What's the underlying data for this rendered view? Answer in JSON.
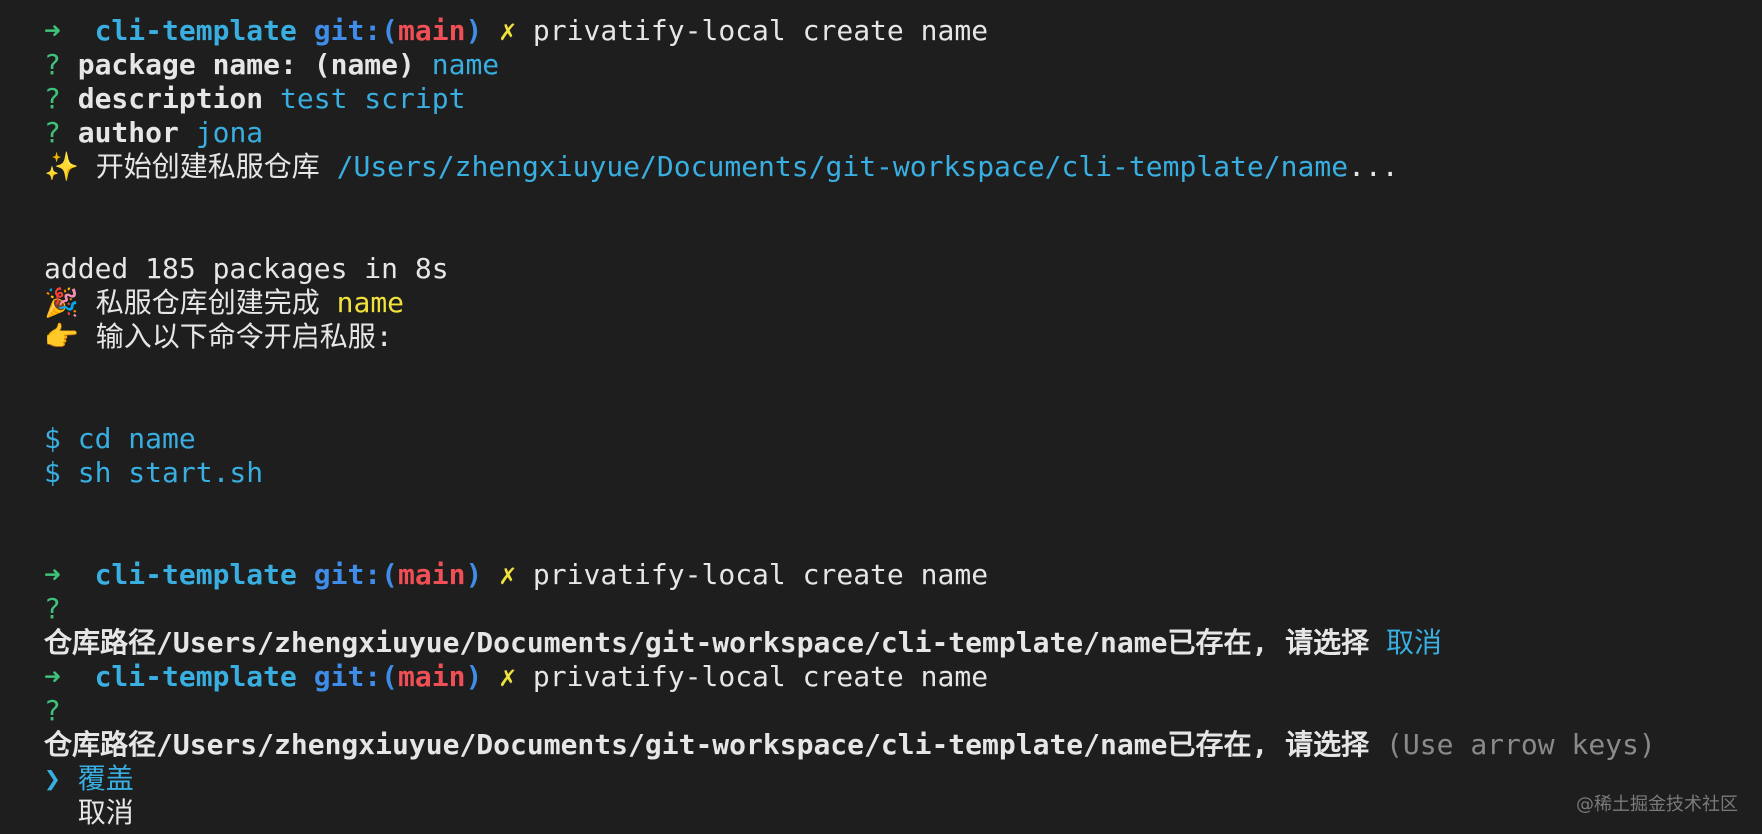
{
  "colors": {
    "background": "#1e1e1e",
    "arrow": "#3ec27a",
    "dir": "#39aee0",
    "git": "#3f8de8",
    "branch": "#ef4f55",
    "dirty": "#f0e23a",
    "answer": "#39aee0",
    "hint": "#8a8a8a"
  },
  "prompt": {
    "arrow": "➜",
    "dir": "cli-template",
    "git_open": "git:(",
    "branch": "main",
    "git_close": ")",
    "dirty": "✗"
  },
  "session1": {
    "command": "privatify-local create name",
    "q_mark": "?",
    "pkg_label": "package name: (name)",
    "pkg_answer": "name",
    "desc_label": "description",
    "desc_answer": "test script",
    "author_label": "author",
    "author_answer": "jona",
    "creating_icon": "✨",
    "creating_text": "开始创建私服仓库",
    "creating_path": "/Users/zhengxiuyue/Documents/git-workspace/cli-template/name",
    "creating_ellipsis": "...",
    "added_text": "added 185 packages in 8s",
    "done_icon": "🎉",
    "done_text": "私服仓库创建完成",
    "done_name": "name",
    "hint_icon": "👉",
    "hint_text": "输入以下命令开启私服:",
    "cmd_prefix": "$",
    "cmd1": "cd name",
    "cmd2": "sh start.sh"
  },
  "session2": {
    "command": "privatify-local create name",
    "q_mark": "?",
    "question": "仓库路径/Users/zhengxiuyue/Documents/git-workspace/cli-template/name已存在, 请选择",
    "answer": "取消"
  },
  "session3": {
    "command": "privatify-local create name",
    "q_mark": "?",
    "question": "仓库路径/Users/zhengxiuyue/Documents/git-workspace/cli-template/name已存在, 请选择",
    "hint": "(Use arrow keys)",
    "pointer": "❯",
    "options": [
      "覆盖",
      "取消"
    ]
  },
  "watermark": "@稀土掘金技术社区"
}
